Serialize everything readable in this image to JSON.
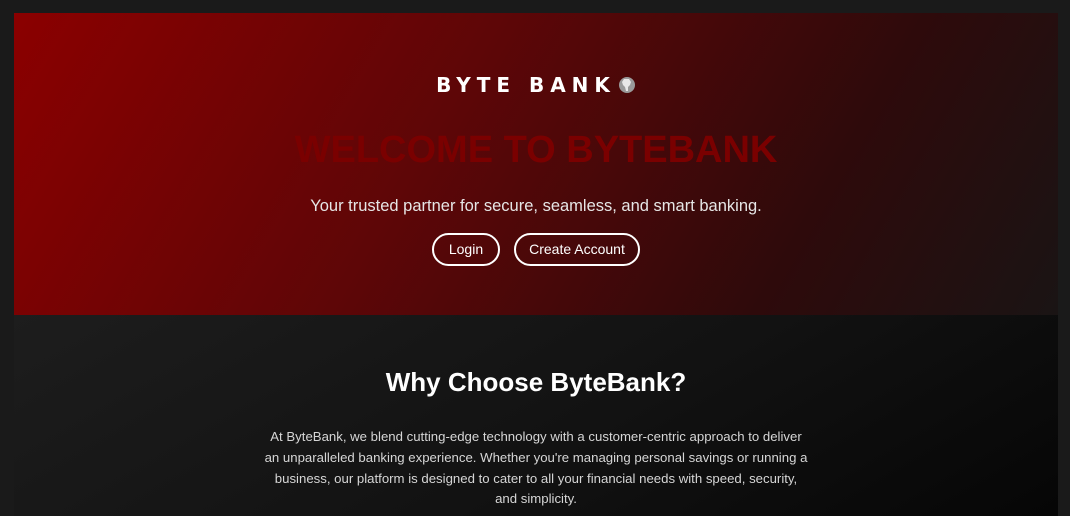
{
  "hero": {
    "logo_text": "BYTE BANK",
    "logo_icon": "africa-globe-icon",
    "title": "WELCOME TO BYTEBANK",
    "subtitle": "Your trusted partner for secure, seamless, and smart banking.",
    "login_label": "Login",
    "create_account_label": "Create Account"
  },
  "why": {
    "title": "Why Choose ByteBank?",
    "body": "At ByteBank, we blend cutting-edge technology with a customer-centric approach to deliver an unparalleled banking experience. Whether you're managing personal savings or running a business, our platform is designed to cater to all your financial needs with speed, security, and simplicity."
  },
  "colors": {
    "accent_red": "#8b0000",
    "title_red": "#7a0000",
    "background_dark": "#121212",
    "text_light": "#e6e6e6"
  }
}
